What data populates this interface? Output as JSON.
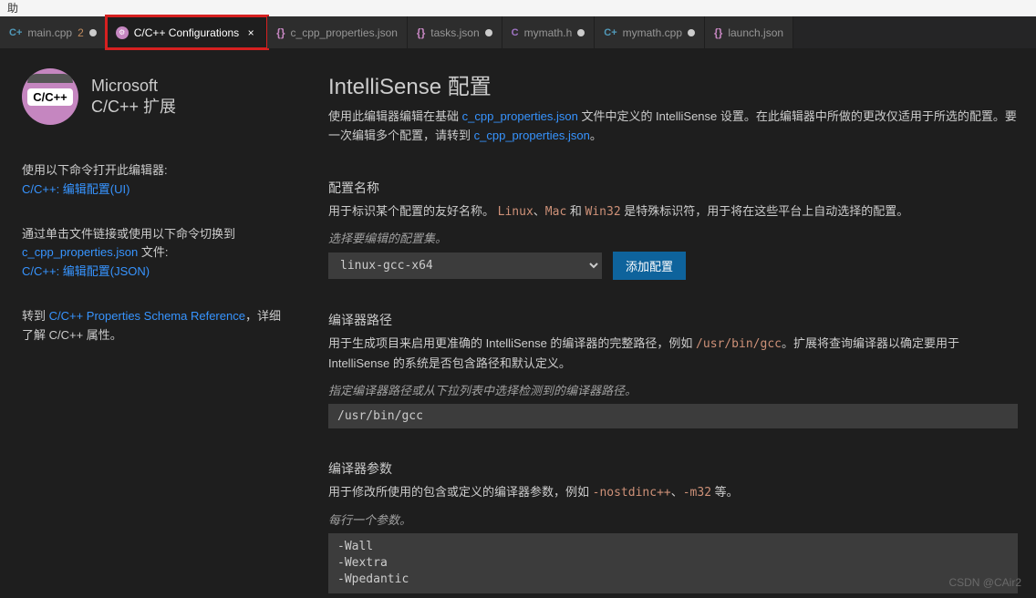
{
  "window": {
    "menu_hint": "助"
  },
  "tabs": [
    {
      "icon": "cpp",
      "label": "main.cpp",
      "suffix": "2",
      "modified": true
    },
    {
      "icon": "ext",
      "label": "C/C++ Configurations",
      "active": true,
      "closable": true
    },
    {
      "icon": "braces",
      "label": "c_cpp_properties.json"
    },
    {
      "icon": "braces",
      "label": "tasks.json",
      "modified": true
    },
    {
      "icon": "c",
      "label": "mymath.h",
      "modified": true
    },
    {
      "icon": "cpp",
      "label": "mymath.cpp",
      "modified": true
    },
    {
      "icon": "braces",
      "label": "launch.json"
    }
  ],
  "sidebar": {
    "ext_logo_text": "C/C++",
    "ext_vendor": "Microsoft",
    "ext_name": "C/C++ 扩展",
    "open_hint": "使用以下命令打开此编辑器:",
    "open_cmd": "C/C++: 编辑配置(UI)",
    "switch_hint_pre": "通过单击文件链接或使用以下命令切换到 ",
    "switch_file": "c_cpp_properties.json",
    "switch_hint_post": " 文件:",
    "switch_cmd": "C/C++: 编辑配置(JSON)",
    "schema_pre": "转到 ",
    "schema_link": "C/C++ Properties Schema Reference",
    "schema_post": "，详细了解 C/C++ 属性。"
  },
  "main": {
    "title": "IntelliSense 配置",
    "desc_pre": "使用此编辑器编辑在基础 ",
    "desc_link1": "c_cpp_properties.json",
    "desc_mid": " 文件中定义的 IntelliSense 设置。在此编辑器中所做的更改仅适用于所选的配置。要一次编辑多个配置，请转到 ",
    "desc_link2": "c_cpp_properties.json",
    "desc_end": "。",
    "config_name": {
      "title": "配置名称",
      "desc_pre": "用于标识某个配置的友好名称。",
      "code1": "Linux",
      "sep1": "、",
      "code2": "Mac",
      "sep2": " 和 ",
      "code3": "Win32",
      "desc_post": " 是特殊标识符，用于将在这些平台上自动选择的配置。",
      "hint": "选择要编辑的配置集。",
      "selected": "linux-gcc-x64",
      "add_btn": "添加配置"
    },
    "compiler_path": {
      "title": "编译器路径",
      "desc_pre": "用于生成项目来启用更准确的 IntelliSense 的编译器的完整路径，例如 ",
      "code": "/usr/bin/gcc",
      "desc_post": "。扩展将查询编译器以确定要用于 IntelliSense 的系统是否包含路径和默认定义。",
      "hint": "指定编译器路径或从下拉列表中选择检测到的编译器路径。",
      "value": "/usr/bin/gcc"
    },
    "compiler_args": {
      "title": "编译器参数",
      "desc_pre": "用于修改所使用的包含或定义的编译器参数，例如 ",
      "code1": "-nostdinc++",
      "sep": "、",
      "code2": "-m32",
      "desc_post": " 等。",
      "hint": "每行一个参数。",
      "value": "-Wall\n-Wextra\n-Wpedantic"
    }
  },
  "watermark": "CSDN @CAir2"
}
